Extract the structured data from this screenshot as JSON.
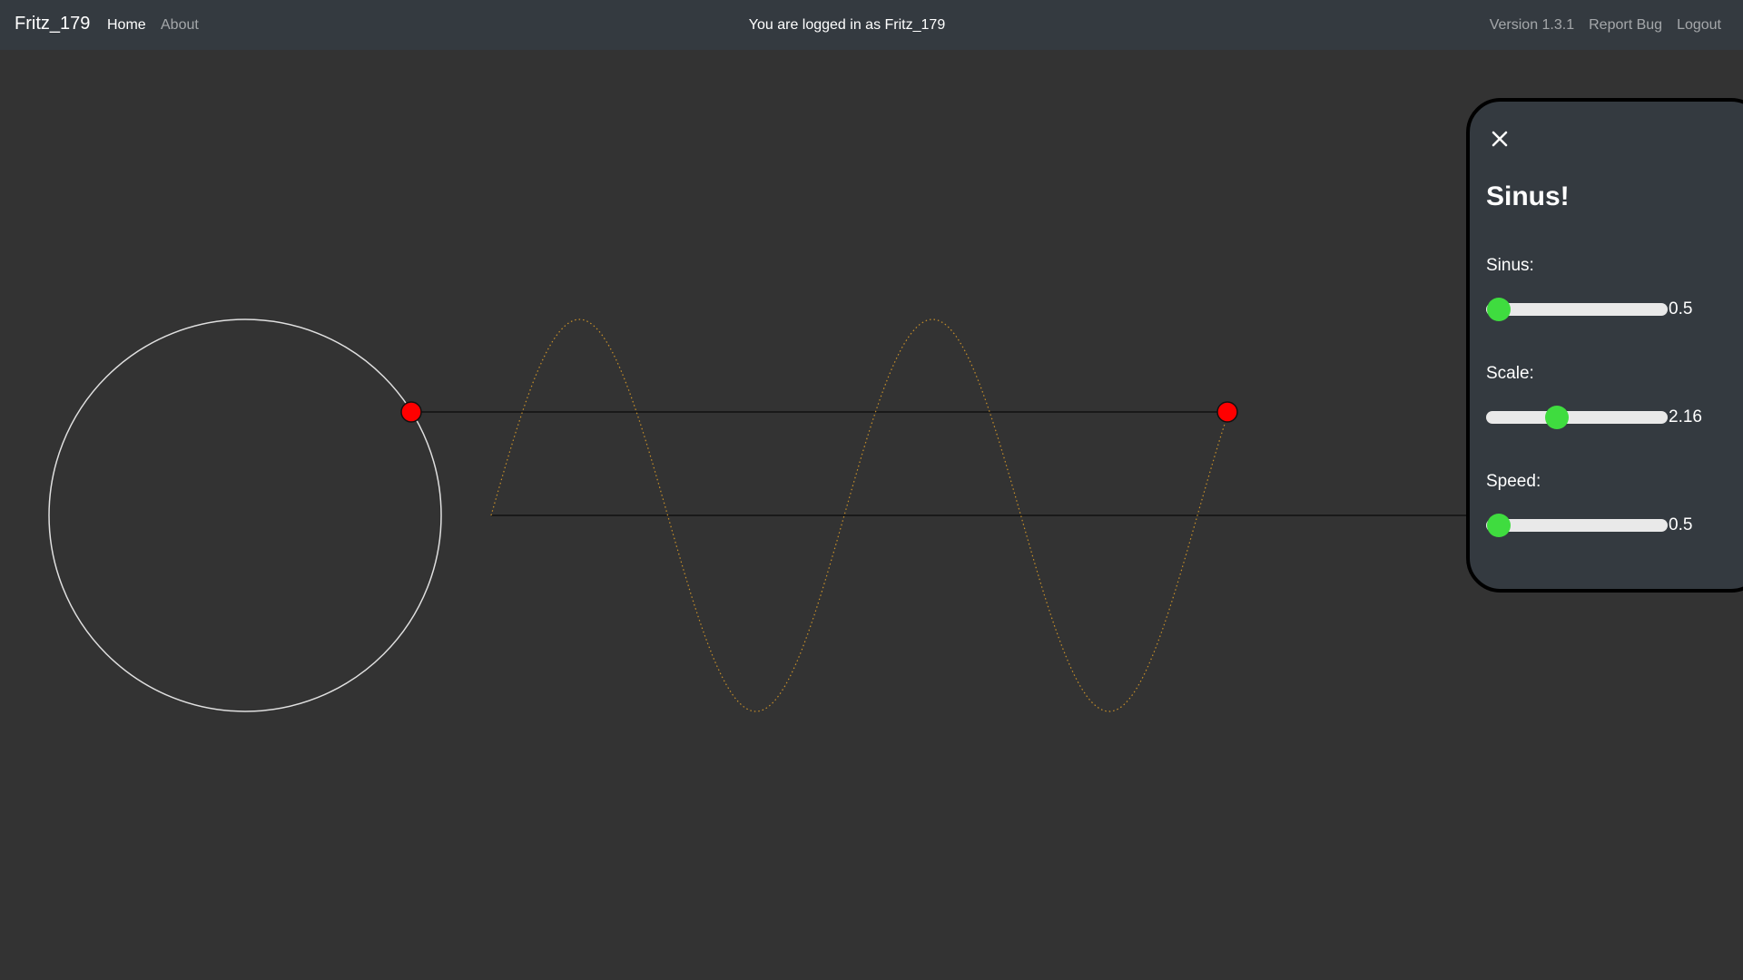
{
  "nav": {
    "brand": "Fritz_179",
    "home": "Home",
    "about": "About",
    "login_status": "You are logged in as Fritz_179",
    "version": "Version 1.3.1",
    "report_bug": "Report Bug",
    "logout": "Logout"
  },
  "panel": {
    "title": "Sinus!",
    "close_icon": "close-icon",
    "sliders": [
      {
        "label": "Sinus:",
        "value": "0.5",
        "fraction": 0.07
      },
      {
        "label": "Scale:",
        "value": "2.16",
        "fraction": 0.39
      },
      {
        "label": "Speed:",
        "value": "0.5",
        "fraction": 0.07
      }
    ]
  },
  "colors": {
    "background": "#333333",
    "navbar": "#343a40",
    "circle": "#e0e0e0",
    "wave": "#c8902a",
    "marker": "#ff0000",
    "slider_thumb": "#3fdc3f",
    "slider_track": "#e9e9e9"
  }
}
